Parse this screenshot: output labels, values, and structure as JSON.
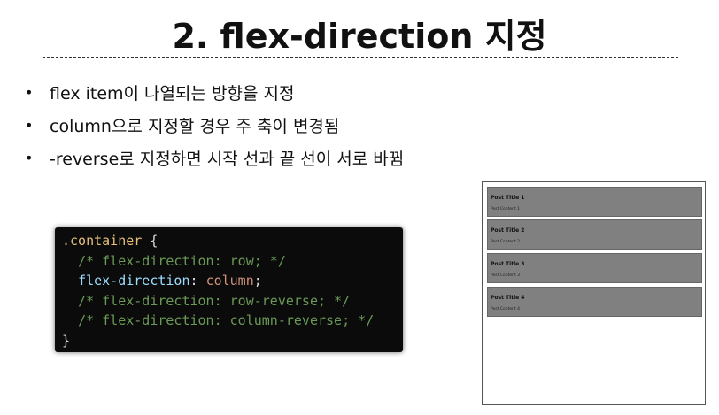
{
  "slide": {
    "title": "2. flex-direction 지정"
  },
  "bullets": [
    "flex item이 나열되는 방향을 지정",
    "column으로 지정할 경우 주 축이 변경됨",
    "-reverse로 지정하면 시작 선과 끝 선이 서로 바뀜"
  ],
  "bullet_symbol": "•",
  "code": {
    "selector": ".container",
    "open_brace": " {",
    "comment_row": "/* flex-direction: row; */",
    "property": "flex-direction",
    "colon": ": ",
    "value": "column",
    "semicolon": ";",
    "comment_row_reverse": "/* flex-direction: row-reverse; */",
    "comment_column_reverse": "/* flex-direction: column-reverse; */",
    "close_brace": "}"
  },
  "preview": {
    "posts": [
      {
        "title": "Post Title 1",
        "content": "Post Content 1"
      },
      {
        "title": "Post Title 2",
        "content": "Post Content 2"
      },
      {
        "title": "Post Title 3",
        "content": "Post Content 3"
      },
      {
        "title": "Post Title 4",
        "content": "Post Content 4"
      }
    ]
  }
}
